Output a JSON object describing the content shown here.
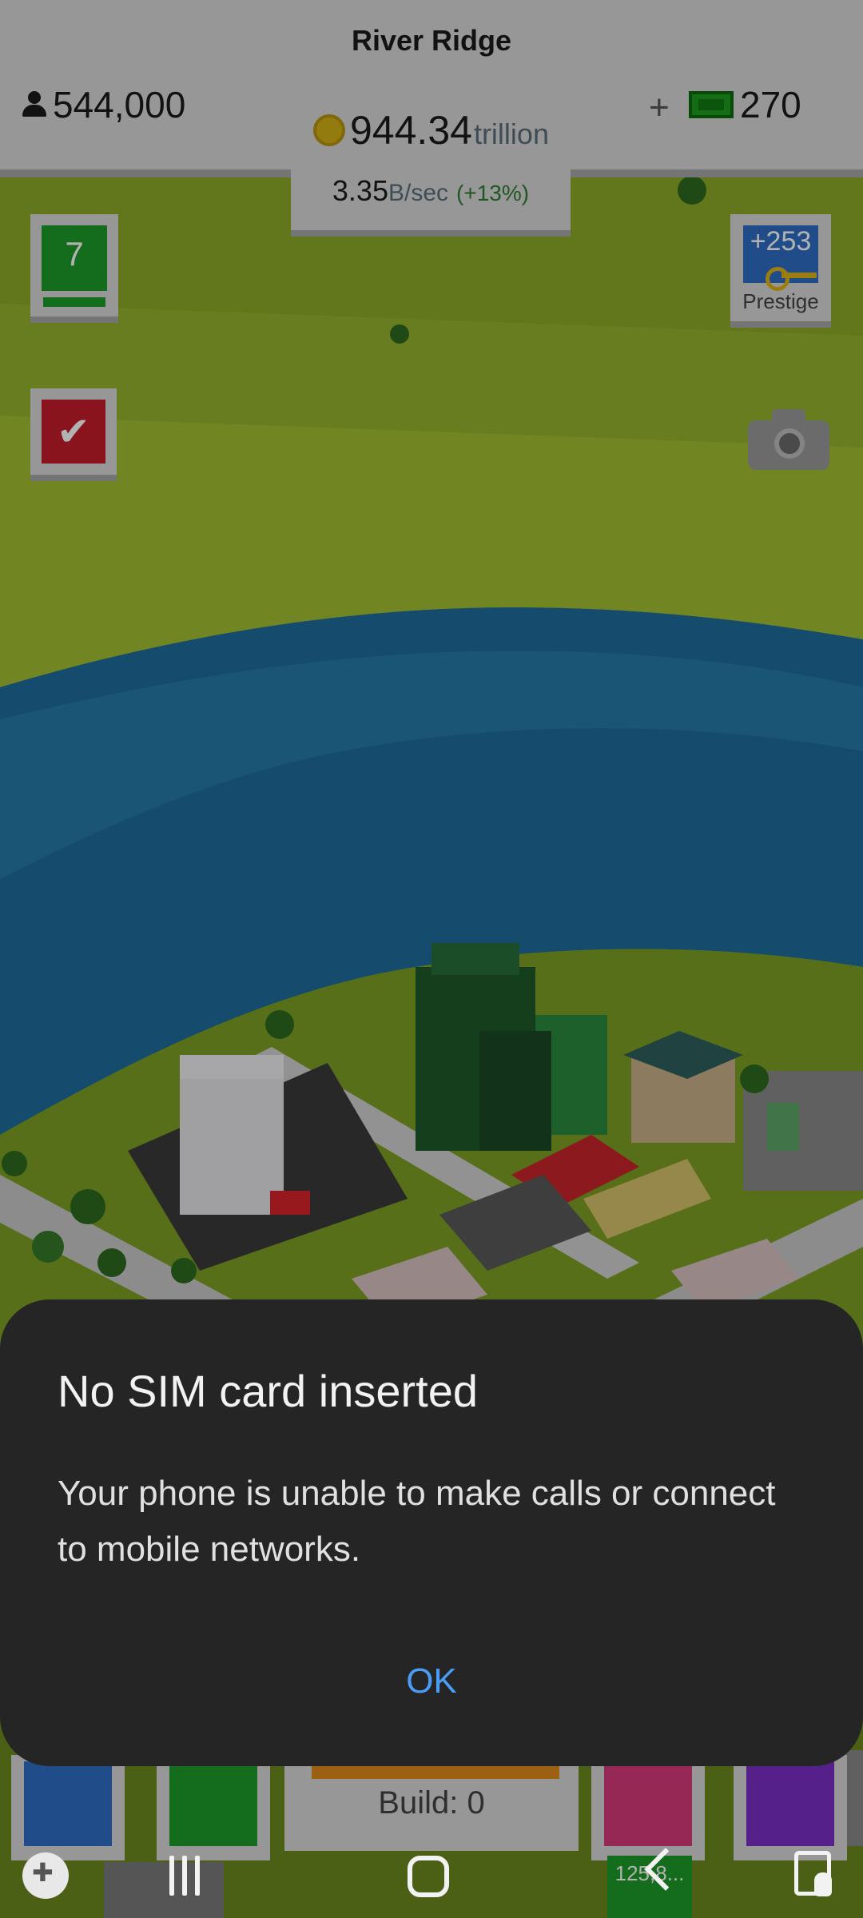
{
  "game": {
    "city_name": "River Ridge",
    "population": "544,000",
    "money_value": "944.34",
    "money_unit": "trillion",
    "income_rate": "3.35",
    "income_unit": "B/sec",
    "income_change": "(+13%)",
    "plus_symbol": "+",
    "cash": "270",
    "level": "7",
    "prestige_bonus": "+253",
    "prestige_label": "Prestige",
    "build_label": "Build: 0",
    "bottom_money": "125,8..."
  },
  "dialog": {
    "title": "No SIM card inserted",
    "message": "Your phone is unable to make calls or connect to mobile networks.",
    "ok_label": "OK"
  },
  "navbar": {
    "items": [
      "game-launcher",
      "recent-apps",
      "home",
      "back",
      "accessibility"
    ]
  },
  "colors": {
    "dialog_bg": "#252525",
    "dialog_accent": "#4b9cf5",
    "hud_bg": "#d9d9d9",
    "level_green": "#1d9b2a",
    "check_red": "#c61e2a",
    "prestige_blue": "#2e6fc4"
  }
}
